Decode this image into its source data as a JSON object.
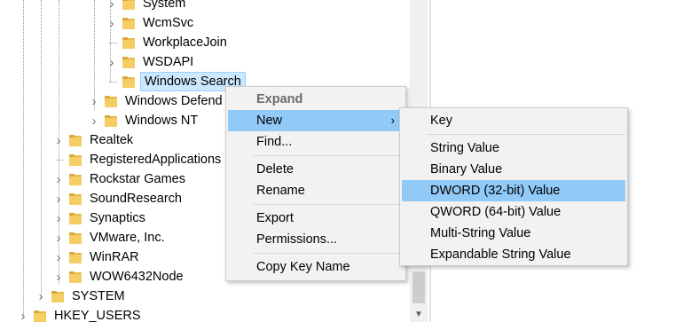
{
  "tree": {
    "items": [
      {
        "label": "System",
        "expander": "collapsed"
      },
      {
        "label": "WcmSvc",
        "expander": "collapsed"
      },
      {
        "label": "WorkplaceJoin",
        "expander": "none"
      },
      {
        "label": "WSDAPI",
        "expander": "collapsed"
      },
      {
        "label": "Windows Search",
        "expander": "none",
        "selected": true
      },
      {
        "label": "Windows Defend",
        "expander": "collapsed"
      },
      {
        "label": "Windows NT",
        "expander": "collapsed"
      },
      {
        "label": "Realtek",
        "expander": "collapsed"
      },
      {
        "label": "RegisteredApplications",
        "expander": "none"
      },
      {
        "label": "Rockstar Games",
        "expander": "collapsed"
      },
      {
        "label": "SoundResearch",
        "expander": "collapsed"
      },
      {
        "label": "Synaptics",
        "expander": "collapsed"
      },
      {
        "label": "VMware, Inc.",
        "expander": "collapsed"
      },
      {
        "label": "WinRAR",
        "expander": "collapsed"
      },
      {
        "label": "WOW6432Node",
        "expander": "collapsed"
      },
      {
        "label": "SYSTEM",
        "expander": "collapsed"
      },
      {
        "label": "HKEY_USERS",
        "expander": "collapsed"
      }
    ]
  },
  "context_menu": {
    "items": [
      {
        "label": "Expand",
        "bold": true
      },
      {
        "label": "New",
        "submenu": true,
        "highlighted": true
      },
      {
        "label": "Find..."
      },
      {
        "label": "Delete"
      },
      {
        "label": "Rename"
      },
      {
        "label": "Export"
      },
      {
        "label": "Permissions..."
      },
      {
        "label": "Copy Key Name"
      }
    ]
  },
  "submenu": {
    "items": [
      {
        "label": "Key"
      },
      {
        "label": "String Value"
      },
      {
        "label": "Binary Value"
      },
      {
        "label": "DWORD (32-bit) Value",
        "highlighted": true
      },
      {
        "label": "QWORD (64-bit) Value"
      },
      {
        "label": "Multi-String Value"
      },
      {
        "label": "Expandable String Value"
      }
    ]
  },
  "colors": {
    "menu_highlight": "#91c9f7",
    "selection": "#cce8ff",
    "folder": "#f5cd62"
  }
}
